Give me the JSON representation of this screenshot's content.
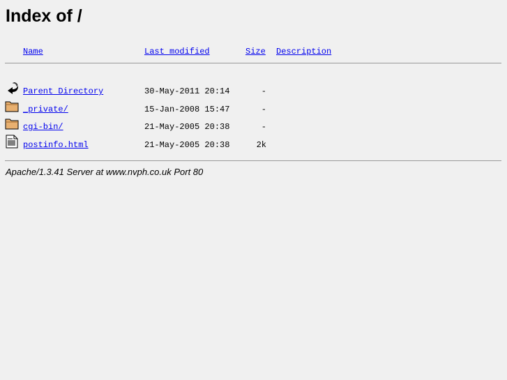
{
  "title": "Index of /",
  "headers": {
    "name": "Name",
    "modified": "Last modified",
    "size": "Size",
    "description": "Description"
  },
  "rows": [
    {
      "icon": "back-icon",
      "name": "Parent Directory",
      "modified": "30-May-2011 20:14",
      "size": "-"
    },
    {
      "icon": "folder-icon",
      "name": "_private/",
      "modified": "15-Jan-2008 15:47",
      "size": "-"
    },
    {
      "icon": "folder-icon",
      "name": "cgi-bin/",
      "modified": "21-May-2005 20:38",
      "size": "-"
    },
    {
      "icon": "text-file-icon",
      "name": "postinfo.html",
      "modified": "21-May-2005 20:38",
      "size": "2k"
    }
  ],
  "footer": "Apache/1.3.41 Server at www.nvph.co.uk Port 80"
}
